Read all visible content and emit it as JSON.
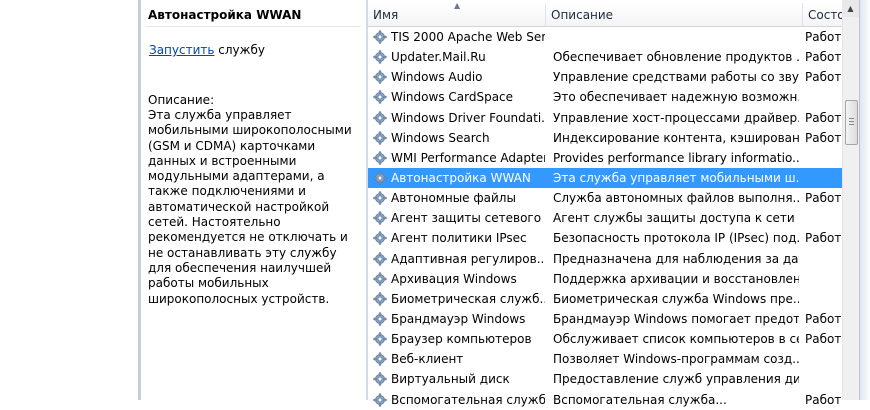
{
  "left_panel": {
    "title": "Автонастройка WWAN",
    "action_link": "Запустить",
    "action_suffix": " службу",
    "description_label": "Описание:",
    "description_text": "Эта служба управляет мобильными широкополосными (GSM и CDMA) карточками данных и встроенными модульными адаптерами, а также подключениями и автоматической настройкой сетей. Настоятельно рекомендуется не отключать и не останавливать эту службу для обеспечения наилучшей работы мобильных широкополосных устройств."
  },
  "columns": {
    "name": "Имя",
    "description": "Описание",
    "status": "Состо"
  },
  "selected_index": 7,
  "rows": [
    {
      "name": "TIS 2000 Apache Web Ser...",
      "description": "",
      "status": "Работа"
    },
    {
      "name": "Updater.Mail.Ru",
      "description": "Обеспечивает обновление продуктов ...",
      "status": "Работа"
    },
    {
      "name": "Windows Audio",
      "description": "Управление средствами работы со зву...",
      "status": "Работа"
    },
    {
      "name": "Windows CardSpace",
      "description": "Это обеспечивает надежную возможн...",
      "status": ""
    },
    {
      "name": "Windows Driver Foundati...",
      "description": "Управление хост-процессами драйвер...",
      "status": "Работа"
    },
    {
      "name": "Windows Search",
      "description": "Индексирование контента, кэширован...",
      "status": "Работа"
    },
    {
      "name": "WMI Performance Adapter",
      "description": "Provides performance library informatio...",
      "status": ""
    },
    {
      "name": "Автонастройка WWAN",
      "description": "Эта служба управляет мобильными ш...",
      "status": ""
    },
    {
      "name": "Автономные файлы",
      "description": "Служба автономных файлов выполня...",
      "status": "Работа"
    },
    {
      "name": "Агент защиты сетевого ...",
      "description": "Агент службы защиты доступа к сети с...",
      "status": ""
    },
    {
      "name": "Агент политики IPsec",
      "description": "Безопасность протокола IP (IPsec) под...",
      "status": "Работа"
    },
    {
      "name": "Адаптивная регулиров...",
      "description": "Предназначена для наблюдения за дат...",
      "status": ""
    },
    {
      "name": "Архивация Windows",
      "description": "Поддержка архивации и восстановлен...",
      "status": ""
    },
    {
      "name": "Биометрическая служб...",
      "description": "Биометрическая служба Windows пре...",
      "status": ""
    },
    {
      "name": "Брандмауэр Windows",
      "description": "Брандмауэр Windows помогает предот...",
      "status": "Работа"
    },
    {
      "name": "Браузер компьютеров",
      "description": "Обслуживает список компьютеров в се...",
      "status": "Работа"
    },
    {
      "name": "Веб-клиент",
      "description": "Позволяет Windows-программам созд...",
      "status": ""
    },
    {
      "name": "Виртуальный диск",
      "description": "Предоставление служб управления ди...",
      "status": ""
    },
    {
      "name": "Вспомогательная служб...",
      "description": "Вспомогательная служба...",
      "status": "Работа"
    }
  ],
  "icons": {
    "service": "gear-icon",
    "sort": "sort-ascending-icon",
    "scroll_up": "scroll-up-arrow-icon"
  },
  "colors": {
    "selection": "#3399ff",
    "link": "#0645ad"
  }
}
